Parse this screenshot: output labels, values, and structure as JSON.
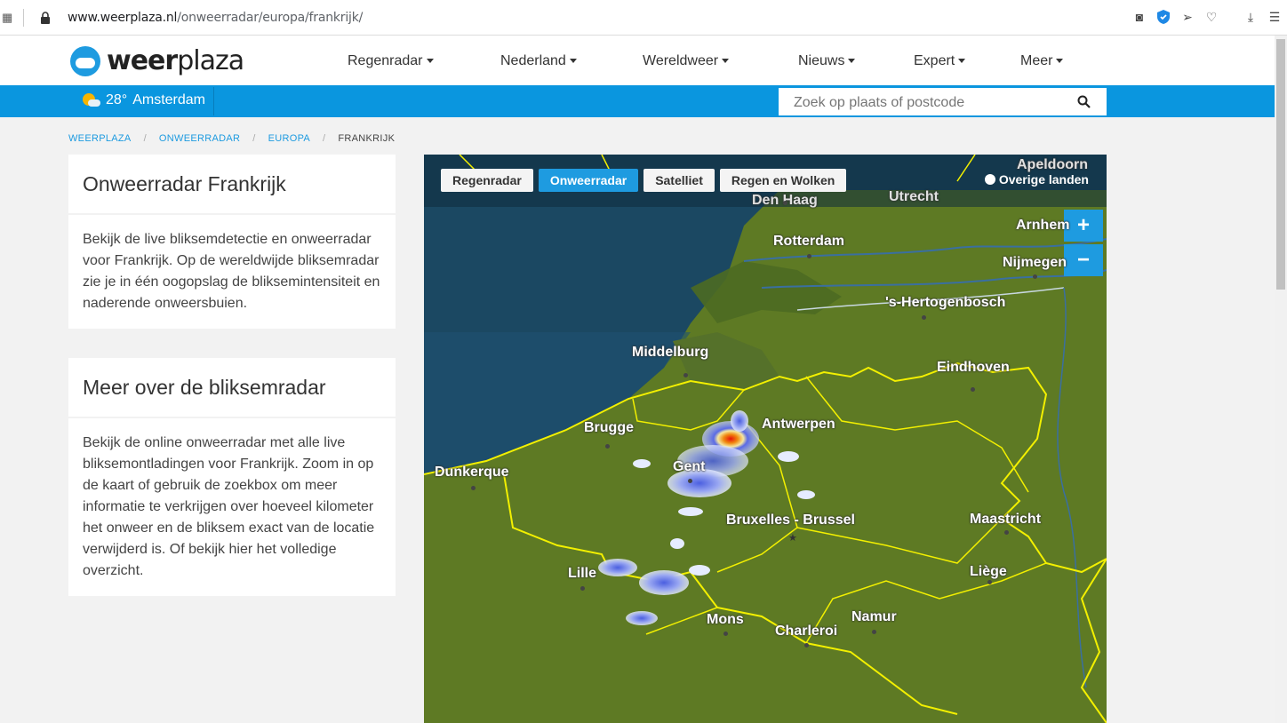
{
  "browser": {
    "url_host": "www.weerplaza.nl",
    "url_path": "/onweerradar/europa/frankrijk/"
  },
  "site": {
    "logo_a": "weer",
    "logo_b": "plaza",
    "nav": [
      "Regenradar",
      "Nederland",
      "Wereldweer",
      "Nieuws",
      "Expert",
      "Meer"
    ]
  },
  "weather": {
    "temp": "28°",
    "place": "Amsterdam"
  },
  "search": {
    "placeholder": "Zoek op plaats of postcode"
  },
  "breadcrumb": [
    "WEERPLAZA",
    "ONWEERRADAR",
    "EUROPA",
    "FRANKRIJK"
  ],
  "card1": {
    "title": "Onweerradar Frankrijk",
    "body": "Bekijk de live bliksemdetectie en onweerradar voor Frankrijk. Op de wereldwijde bliksemradar zie je in één oogopslag de bliksemintensiteit en naderende onweersbuien."
  },
  "card2": {
    "title": "Meer over de bliksemradar",
    "body": "Bekijk de online onweerradar met alle live bliksemontladingen voor Frankrijk. Zoom in op de kaart of gebruik de zoekbox om meer informatie te verkrijgen over hoeveel kilometer het onweer en de bliksem exact van de locatie verwijderd is. Of bekijk hier het volledige overzicht."
  },
  "map": {
    "tabs": [
      "Regenradar",
      "Onweerradar",
      "Satelliet",
      "Regen en Wolken"
    ],
    "active_tab": "Onweerradar",
    "other": "Overige landen",
    "zoom_in": "+",
    "zoom_out": "−",
    "cities": {
      "apeldoorn": "Apeldoorn",
      "den_haag": "Den Haag",
      "utrecht": "Utrecht",
      "rotterdam": "Rotterdam",
      "arnhem": "Arnhem",
      "nijmegen": "Nijmegen",
      "hertogenbosch": "'s-Hertogenbosch",
      "middelburg": "Middelburg",
      "eindhoven": "Eindhoven",
      "brugge": "Brugge",
      "antwerpen": "Antwerpen",
      "gent": "Gent",
      "dunkerque": "Dunkerque",
      "bruxelles": "Bruxelles - Brussel",
      "maastricht": "Maastricht",
      "lille": "Lille",
      "liege": "Liège",
      "mons": "Mons",
      "charleroi": "Charleroi",
      "namur": "Namur"
    }
  },
  "colors": {
    "accent": "#1e9be0",
    "bar": "#0a96df",
    "land": "#5e7a24",
    "sea": "#1d4a66",
    "border": "#f3f000"
  }
}
